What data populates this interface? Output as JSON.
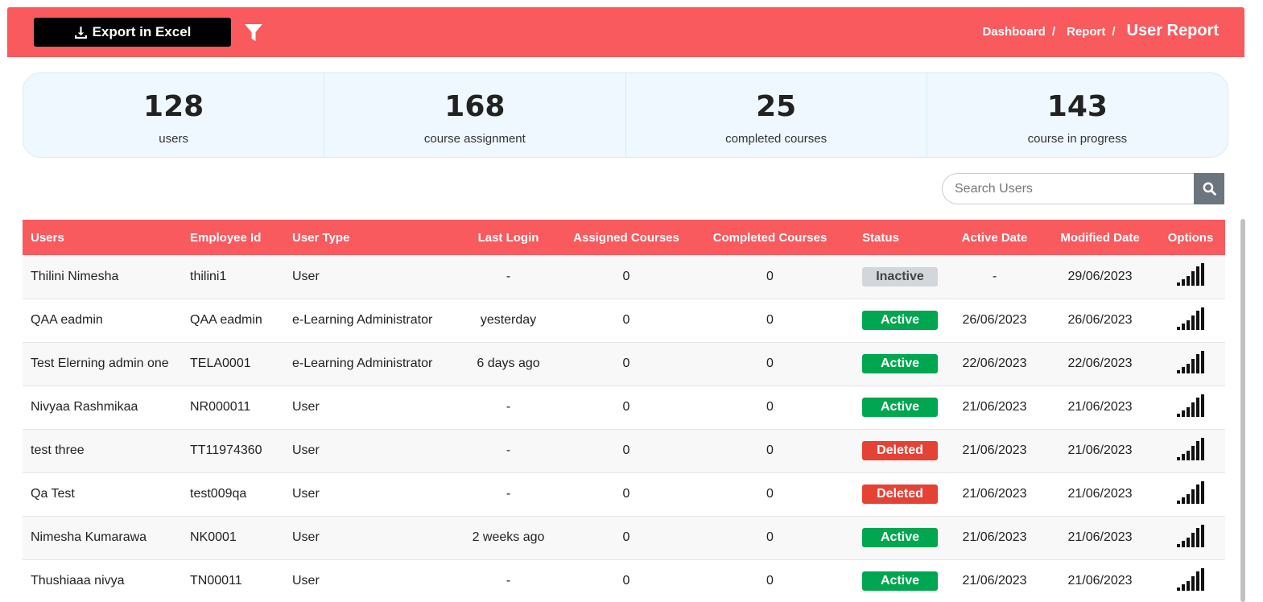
{
  "header": {
    "export_label": "Export in Excel",
    "breadcrumb": {
      "dashboard": "Dashboard",
      "report": "Report",
      "current": "User Report",
      "separator": "/"
    }
  },
  "stats": [
    {
      "value": "128",
      "label": "users"
    },
    {
      "value": "168",
      "label": "course assignment"
    },
    {
      "value": "25",
      "label": "completed courses"
    },
    {
      "value": "143",
      "label": "course in progress"
    }
  ],
  "search": {
    "placeholder": "Search Users",
    "value": ""
  },
  "table": {
    "columns": [
      "Users",
      "Employee Id",
      "User Type",
      "Last Login",
      "Assigned Courses",
      "Completed Courses",
      "Status",
      "Active Date",
      "Modified Date",
      "Options"
    ],
    "rows": [
      {
        "user": "Thilini Nimesha",
        "emp_id": "thilini1",
        "type": "User",
        "last_login": "-",
        "assigned": "0",
        "completed": "0",
        "status": "Inactive",
        "active_date": "-",
        "modified": "29/06/2023"
      },
      {
        "user": "QAA eadmin",
        "emp_id": "QAA eadmin",
        "type": "e-Learning Administrator",
        "last_login": "yesterday",
        "assigned": "0",
        "completed": "0",
        "status": "Active",
        "active_date": "26/06/2023",
        "modified": "26/06/2023"
      },
      {
        "user": "Test Elerning admin one",
        "emp_id": "TELA0001",
        "type": "e-Learning Administrator",
        "last_login": "6 days ago",
        "assigned": "0",
        "completed": "0",
        "status": "Active",
        "active_date": "22/06/2023",
        "modified": "22/06/2023"
      },
      {
        "user": "Nivyaa Rashmikaa",
        "emp_id": "NR000011",
        "type": "User",
        "last_login": "-",
        "assigned": "0",
        "completed": "0",
        "status": "Active",
        "active_date": "21/06/2023",
        "modified": "21/06/2023"
      },
      {
        "user": "test three",
        "emp_id": "TT11974360",
        "type": "User",
        "last_login": "-",
        "assigned": "0",
        "completed": "0",
        "status": "Deleted",
        "active_date": "21/06/2023",
        "modified": "21/06/2023"
      },
      {
        "user": "Qa Test",
        "emp_id": "test009qa",
        "type": "User",
        "last_login": "-",
        "assigned": "0",
        "completed": "0",
        "status": "Deleted",
        "active_date": "21/06/2023",
        "modified": "21/06/2023"
      },
      {
        "user": "Nimesha Kumarawa",
        "emp_id": "NK0001",
        "type": "User",
        "last_login": "2 weeks ago",
        "assigned": "0",
        "completed": "0",
        "status": "Active",
        "active_date": "21/06/2023",
        "modified": "21/06/2023"
      },
      {
        "user": "Thushiaaa nivya",
        "emp_id": "TN00011",
        "type": "User",
        "last_login": "-",
        "assigned": "0",
        "completed": "0",
        "status": "Active",
        "active_date": "21/06/2023",
        "modified": "21/06/2023"
      }
    ]
  },
  "icons": {
    "export": "download-icon",
    "filter": "filter-icon",
    "search": "search-icon",
    "options": "signal-bars-icon"
  },
  "colors": {
    "brand": "#f85a5e",
    "active": "#00a650",
    "deleted": "#e54235",
    "inactive": "#d3d7db",
    "stats_bg": "#eef8fe"
  }
}
